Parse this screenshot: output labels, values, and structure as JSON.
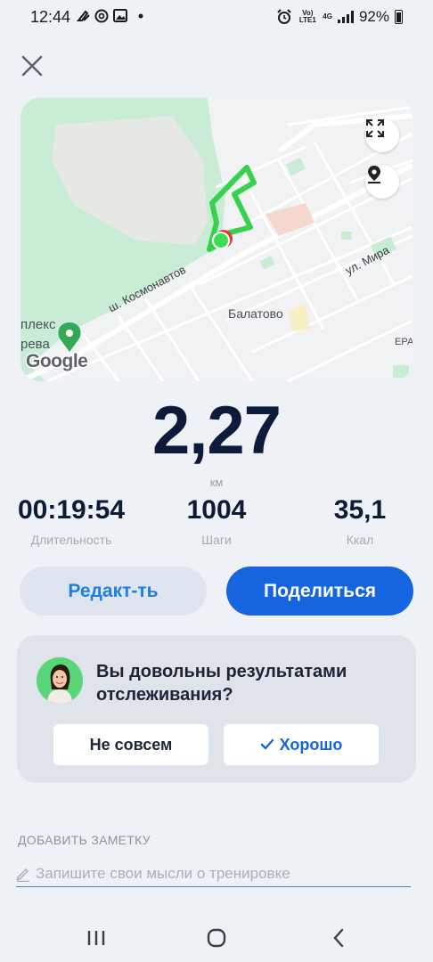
{
  "status_bar": {
    "time": "12:44",
    "battery": "92%",
    "network_tag": "Vo) LTE1",
    "network_gen": "4G"
  },
  "map": {
    "place_label": "Балатово",
    "street_1": "ш. Космонавтов",
    "street_2": "ул. Мира",
    "poi_label_1": "плекс",
    "poi_label_2": "рева",
    "edge_label": "ЕРА",
    "logo": "Google",
    "route_color": "#3ddc52"
  },
  "workout": {
    "distance": "2,27",
    "distance_unit": "км",
    "stats": [
      {
        "value": "00:19:54",
        "label": "Длительность"
      },
      {
        "value": "1004",
        "label": "Шаги"
      },
      {
        "value": "35,1",
        "label": "Ккал"
      }
    ]
  },
  "actions": {
    "edit_label": "Редакт-ть",
    "share_label": "Поделиться"
  },
  "survey": {
    "question": "Вы довольны результатами отслеживания?",
    "no_label": "Не совсем",
    "yes_label": "Хорошо"
  },
  "note": {
    "title": "ДОБАВИТЬ ЗАМЕТКУ",
    "placeholder": "Запишите свои мысли о тренировке"
  },
  "colors": {
    "accent": "#1565e0",
    "background": "#eef1f6",
    "dark_text": "#0d1b3a"
  }
}
